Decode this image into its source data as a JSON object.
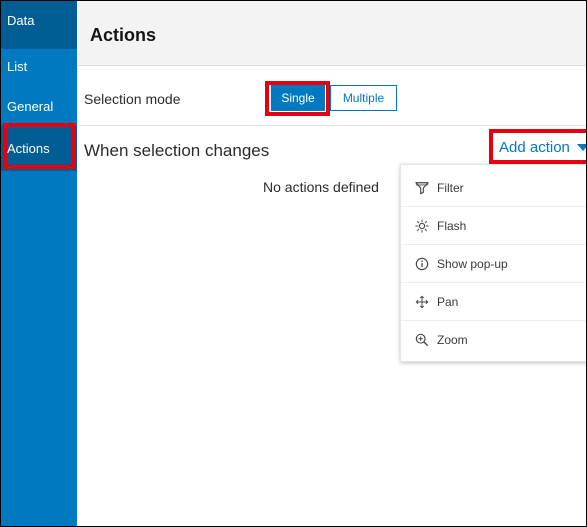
{
  "sidebar": {
    "items": [
      {
        "label": "Data"
      },
      {
        "label": "List"
      },
      {
        "label": "General"
      },
      {
        "label": "Actions"
      }
    ],
    "active": "Actions"
  },
  "header": {
    "title": "Actions"
  },
  "selection_mode": {
    "label": "Selection mode",
    "options": [
      {
        "label": "Single",
        "selected": true
      },
      {
        "label": "Multiple",
        "selected": false
      }
    ]
  },
  "actions_section": {
    "label": "When selection changes",
    "add_action_label": "Add action",
    "empty_message": "No actions defined"
  },
  "menu": {
    "items": [
      {
        "label": "Filter",
        "icon": "filter-icon"
      },
      {
        "label": "Flash",
        "icon": "flash-icon"
      },
      {
        "label": "Show pop-up",
        "icon": "info-icon"
      },
      {
        "label": "Pan",
        "icon": "pan-icon"
      },
      {
        "label": "Zoom",
        "icon": "zoom-in-icon"
      }
    ]
  },
  "colors": {
    "brand_blue": "#0079c1",
    "sidebar_active": "#005e95",
    "highlight_red": "#e6000f"
  }
}
